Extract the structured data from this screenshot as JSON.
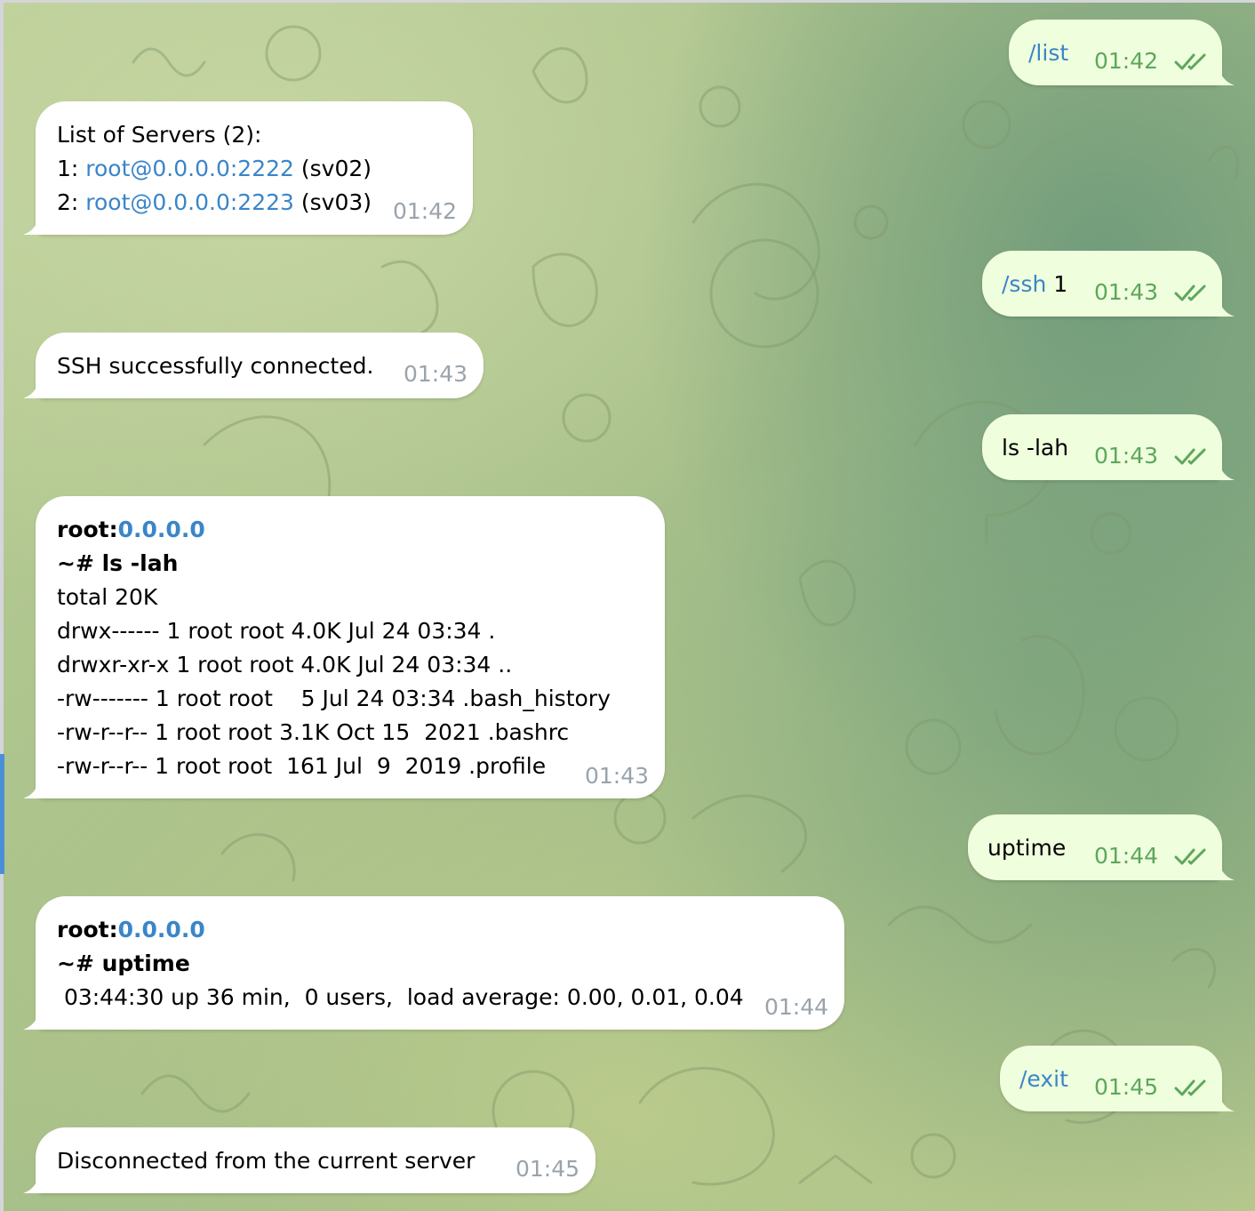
{
  "messages": [
    {
      "id": "m1",
      "direction": "outgoing",
      "command": "/list",
      "text": "",
      "time": "01:42",
      "status": "read"
    },
    {
      "id": "m2",
      "direction": "incoming",
      "time": "01:42",
      "title": "List of Servers (2):",
      "servers": [
        {
          "prefix": "1: ",
          "address": "root@0.0.0.0:2222",
          "label": " (sv02)"
        },
        {
          "prefix": "2: ",
          "address": "root@0.0.0.0:2223",
          "label": " (sv03)"
        }
      ]
    },
    {
      "id": "m3",
      "direction": "outgoing",
      "command": "/ssh",
      "text": " 1",
      "time": "01:43",
      "status": "read"
    },
    {
      "id": "m4",
      "direction": "incoming",
      "text": "SSH successfully connected.",
      "time": "01:43"
    },
    {
      "id": "m5",
      "direction": "outgoing",
      "command": "",
      "text": "ls -lah",
      "time": "01:43",
      "status": "read"
    },
    {
      "id": "m6",
      "direction": "incoming",
      "time": "01:43",
      "prompt_user": "root:",
      "prompt_host": "0.0.0.0",
      "prompt_cmd": "~# ls -lah",
      "lines": [
        "total 20K",
        "drwx------ 1 root root 4.0K Jul 24 03:34 .",
        "drwxr-xr-x 1 root root 4.0K Jul 24 03:34 ..",
        "-rw------- 1 root root    5 Jul 24 03:34 .bash_history",
        "-rw-r--r-- 1 root root 3.1K Oct 15  2021 .bashrc",
        "-rw-r--r-- 1 root root  161 Jul  9  2019 .profile"
      ]
    },
    {
      "id": "m7",
      "direction": "outgoing",
      "command": "",
      "text": "uptime",
      "time": "01:44",
      "status": "read"
    },
    {
      "id": "m8",
      "direction": "incoming",
      "time": "01:44",
      "prompt_user": "root:",
      "prompt_host": "0.0.0.0",
      "prompt_cmd": "~# uptime",
      "lines": [
        " 03:44:30 up 36 min,  0 users,  load average: 0.00, 0.01, 0.04"
      ]
    },
    {
      "id": "m9",
      "direction": "outgoing",
      "command": "/exit",
      "text": "",
      "time": "01:45",
      "status": "read"
    },
    {
      "id": "m10",
      "direction": "incoming",
      "text": "Disconnected from the current server",
      "time": "01:45"
    }
  ],
  "colors": {
    "incoming_bubble": "#ffffff",
    "outgoing_bubble": "#effedd",
    "link": "#3a85c9",
    "outgoing_time": "#5da75c",
    "incoming_time": "#9aa3ab",
    "selection_marker": "#4a8fd6"
  },
  "icons": {
    "read_status": "double-check-icon",
    "background": "chat-wallpaper-doodles"
  }
}
